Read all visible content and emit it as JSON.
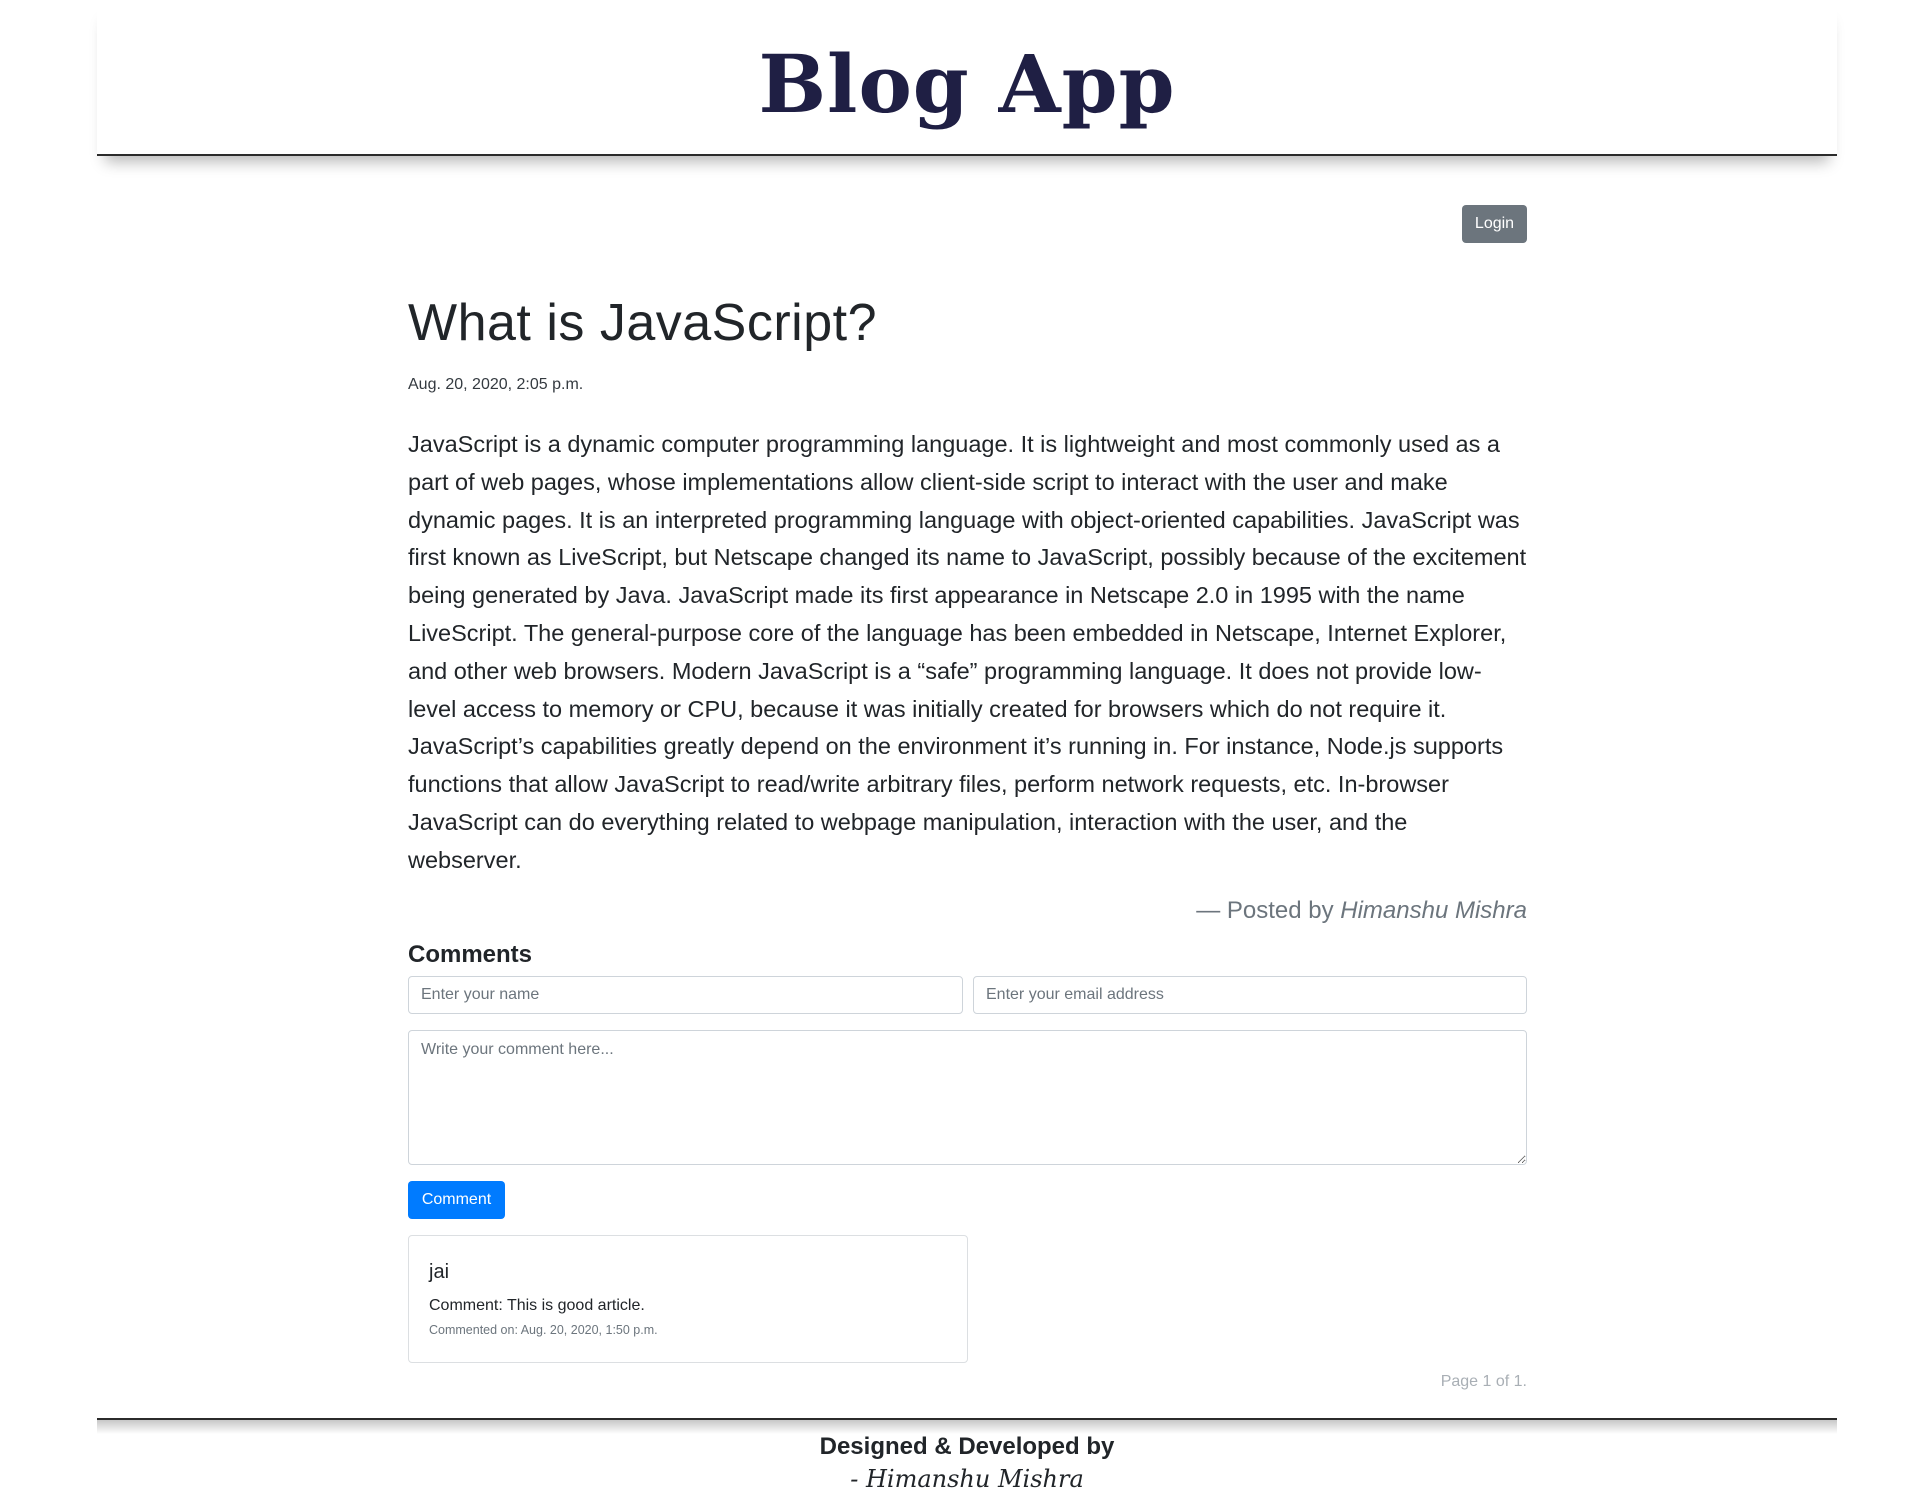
{
  "header": {
    "brand": "Blog App"
  },
  "auth": {
    "login_label": "Login"
  },
  "post": {
    "title": "What is JavaScript?",
    "date": "Aug. 20, 2020, 2:05 p.m.",
    "body": "JavaScript is a dynamic computer programming language. It is lightweight and most commonly used as a part of web pages, whose implementations allow client-side script to interact with the user and make dynamic pages. It is an interpreted programming language with object-oriented capabilities. JavaScript was first known as LiveScript, but Netscape changed its name to JavaScript, possibly because of the excitement being generated by Java. JavaScript made its first appearance in Netscape 2.0 in 1995 with the name LiveScript. The general-purpose core of the language has been embedded in Netscape, Internet Explorer, and other web browsers. Modern JavaScript is a “safe” programming language. It does not provide low-level access to memory or CPU, because it was initially created for browsers which do not require it. JavaScript’s capabilities greatly depend on the environment it’s running in. For instance, Node.js supports functions that allow JavaScript to read/write arbitrary files, perform network requests, etc. In-browser JavaScript can do everything related to webpage manipulation, interaction with the user, and the webserver.",
    "byline_prefix": "— Posted by ",
    "author": "Himanshu Mishra"
  },
  "comments": {
    "heading": "Comments",
    "name_placeholder": "Enter your name",
    "email_placeholder": "Enter your email address",
    "comment_placeholder": "Write your comment here...",
    "submit_label": "Comment",
    "items": [
      {
        "name": "jai",
        "text": "Comment: This is good article.",
        "meta": "Commented on: Aug. 20, 2020, 1:50 p.m."
      }
    ],
    "pagination": "Page 1 of 1."
  },
  "footer": {
    "line1": "Designed & Developed by",
    "line2": "- Himanshu Mishra"
  },
  "colors": {
    "brand": "#1f1f44",
    "login_button": "#6c757d",
    "comment_button": "#007bff"
  }
}
